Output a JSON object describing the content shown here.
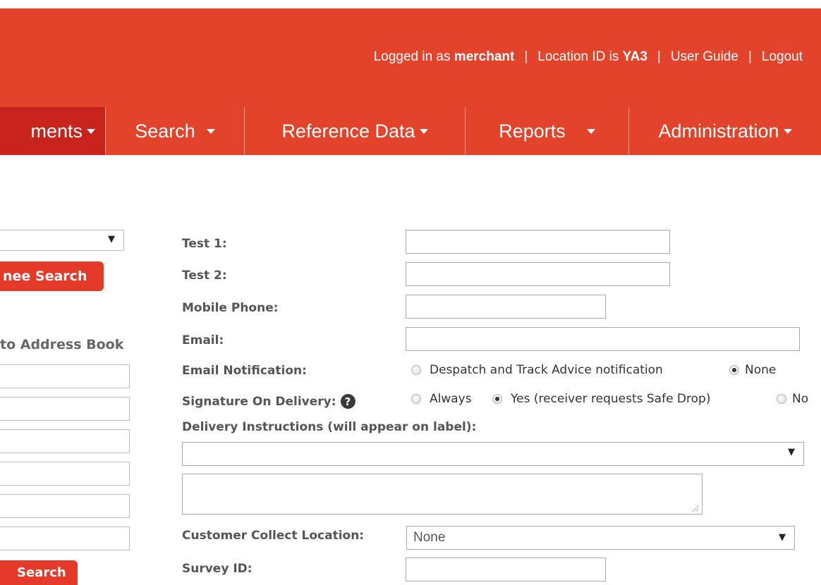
{
  "header": {
    "logged_in_prefix": "Logged in as",
    "username": "merchant",
    "location_prefix": "Location ID is",
    "location_id": "YA3",
    "user_guide": "User Guide",
    "logout": "Logout"
  },
  "nav": {
    "items": [
      "ments",
      "Search",
      "Reference Data",
      "Reports",
      "Administration"
    ]
  },
  "left": {
    "search_button": "nee Search",
    "address_book_label": "to Address Book",
    "bottom_search_button": "Search"
  },
  "form": {
    "test1_label": "Test 1:",
    "test2_label": "Test 2:",
    "mobile_label": "Mobile Phone:",
    "email_label": "Email:",
    "email_notification_label": "Email Notification:",
    "email_notification_options": [
      "Despatch and Track Advice notification",
      "None"
    ],
    "email_notification_selected": "None",
    "signature_label": "Signature On Delivery:",
    "signature_options": [
      "Always",
      "Yes (receiver requests Safe Drop)",
      "No"
    ],
    "signature_selected": "Yes (receiver requests Safe Drop)",
    "help_glyph": "?",
    "delivery_instructions_label": "Delivery Instructions (will appear on label):",
    "customer_collect_label": "Customer Collect Location:",
    "customer_collect_value": "None",
    "survey_label": "Survey ID:"
  },
  "colors": {
    "brand_red": "#e3432b",
    "active_nav": "#c8241c"
  }
}
